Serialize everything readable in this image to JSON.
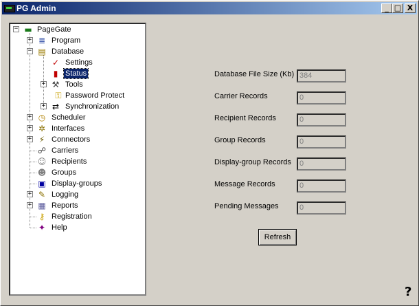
{
  "window": {
    "title": "PG Admin",
    "minimize": "_",
    "maximize": "□",
    "close": "X"
  },
  "tree": [
    {
      "label": "PageGate",
      "expander": "−",
      "icon": "▬"
    },
    {
      "label": "Program",
      "expander": "+",
      "icon": "≣"
    },
    {
      "label": "Database",
      "expander": "−",
      "icon": "▤"
    },
    {
      "label": "Settings",
      "expander": "",
      "icon": "✓"
    },
    {
      "label": "Status",
      "expander": "",
      "icon": "▮"
    },
    {
      "label": "Tools",
      "expander": "+",
      "icon": "⚒"
    },
    {
      "label": "Password Protect",
      "expander": "",
      "icon": "⚿"
    },
    {
      "label": "Synchronization",
      "expander": "+",
      "icon": "⇄"
    },
    {
      "label": "Scheduler",
      "expander": "+",
      "icon": "◷"
    },
    {
      "label": "Interfaces",
      "expander": "+",
      "icon": "✲"
    },
    {
      "label": "Connectors",
      "expander": "+",
      "icon": "⚡"
    },
    {
      "label": "Carriers",
      "expander": "",
      "icon": "☍"
    },
    {
      "label": "Recipients",
      "expander": "",
      "icon": "☺"
    },
    {
      "label": "Groups",
      "expander": "",
      "icon": "☻"
    },
    {
      "label": "Display-groups",
      "expander": "",
      "icon": "▣"
    },
    {
      "label": "Logging",
      "expander": "+",
      "icon": "✎"
    },
    {
      "label": "Reports",
      "expander": "+",
      "icon": "▦"
    },
    {
      "label": "Registration",
      "expander": "",
      "icon": "⚷"
    },
    {
      "label": "Help",
      "expander": "",
      "icon": "✦"
    }
  ],
  "stats": [
    {
      "label": "Database File Size (Kb)",
      "value": "384"
    },
    {
      "label": "Carrier Records",
      "value": "0"
    },
    {
      "label": "Recipient Records",
      "value": "0"
    },
    {
      "label": "Group Records",
      "value": "0"
    },
    {
      "label": "Display-group Records",
      "value": "0"
    },
    {
      "label": "Message Records",
      "value": "0"
    },
    {
      "label": "Pending Messages",
      "value": "0"
    }
  ],
  "refresh_label": "Refresh",
  "help_glyph": "?",
  "colors": {
    "titlebar_start": "#0a246a",
    "titlebar_end": "#a6caf0",
    "selection": "#0a246a",
    "face": "#d4d0c8"
  }
}
